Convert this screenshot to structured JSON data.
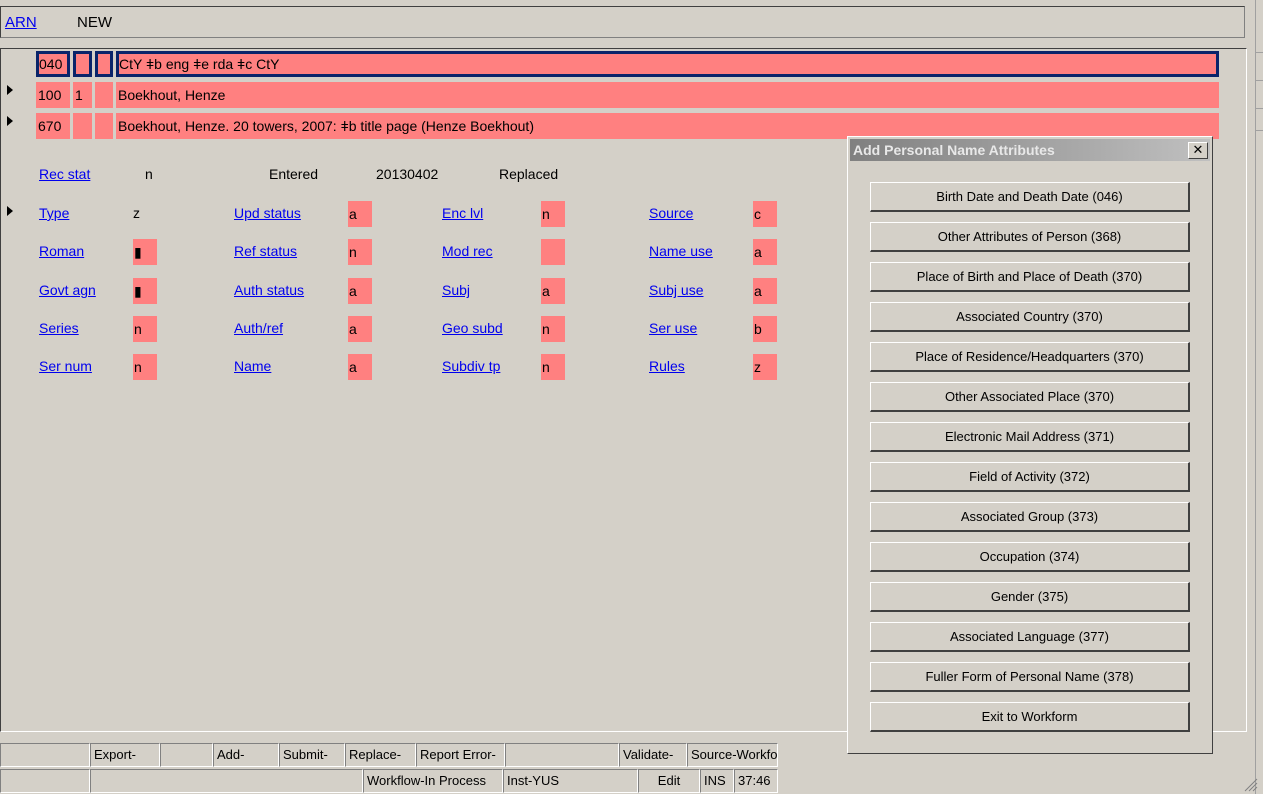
{
  "header": {
    "arn_label": "ARN",
    "arn_value": "NEW"
  },
  "marc_fields": [
    {
      "tag": "040",
      "ind1": "",
      "ind2": "",
      "data": "CtY ǂb eng ǂe rda ǂc CtY",
      "selected": true,
      "arrow": false
    },
    {
      "tag": "100",
      "ind1": "1",
      "ind2": "",
      "data": "Boekhout, Henze",
      "selected": false,
      "arrow": true
    },
    {
      "tag": "670",
      "ind1": "",
      "ind2": "",
      "data": "Boekhout, Henze. 20 towers, 2007: ǂb title page (Henze Boekhout)",
      "selected": false,
      "arrow": true
    }
  ],
  "fixed_fields": {
    "rec_stat_label": "Rec stat",
    "rec_stat_value": "n",
    "entered_label": "Entered",
    "entered_value": "20130402",
    "replaced_label": "Replaced",
    "rows": [
      [
        {
          "label": "Type",
          "value": "z",
          "plain": true
        },
        {
          "label": "Upd status",
          "value": "a"
        },
        {
          "label": "Enc lvl",
          "value": "n"
        },
        {
          "label": "Source",
          "value": "c"
        }
      ],
      [
        {
          "label": "Roman",
          "value": "▮"
        },
        {
          "label": "Ref status",
          "value": "n"
        },
        {
          "label": "Mod rec",
          "value": ""
        },
        {
          "label": "Name use",
          "value": "a"
        }
      ],
      [
        {
          "label": "Govt agn",
          "value": "▮"
        },
        {
          "label": "Auth status",
          "value": "a"
        },
        {
          "label": "Subj",
          "value": "a"
        },
        {
          "label": "Subj use",
          "value": "a"
        }
      ],
      [
        {
          "label": "Series",
          "value": "n"
        },
        {
          "label": "Auth/ref",
          "value": "a"
        },
        {
          "label": "Geo subd",
          "value": "n"
        },
        {
          "label": "Ser use",
          "value": "b"
        }
      ],
      [
        {
          "label": "Ser num",
          "value": "n"
        },
        {
          "label": "Name",
          "value": "a"
        },
        {
          "label": "Subdiv tp",
          "value": "n"
        },
        {
          "label": "Rules",
          "value": "z"
        }
      ]
    ]
  },
  "dialog": {
    "title": "Add Personal Name Attributes",
    "close_label": "✕",
    "buttons": [
      "Birth Date and Death Date (046)",
      "Other Attributes of Person (368)",
      "Place of Birth and Place of Death (370)",
      "Associated Country (370)",
      "Place of Residence/Headquarters (370)",
      "Other Associated Place (370)",
      "Electronic Mail Address (371)",
      "Field of Activity (372)",
      "Associated Group (373)",
      "Occupation (374)",
      "Gender (375)",
      "Associated Language (377)",
      "Fuller Form of Personal Name (378)",
      "Exit to Workform"
    ]
  },
  "toolbar": [
    "",
    "Export-",
    "",
    "Add-",
    "Submit-",
    "Replace-",
    "Report Error-",
    "",
    "Validate-",
    "Source-Workfo"
  ],
  "statusbar": [
    "",
    "",
    "Workflow-In Process",
    "Inst-YUS",
    "Edit",
    "INS",
    "37:46"
  ]
}
